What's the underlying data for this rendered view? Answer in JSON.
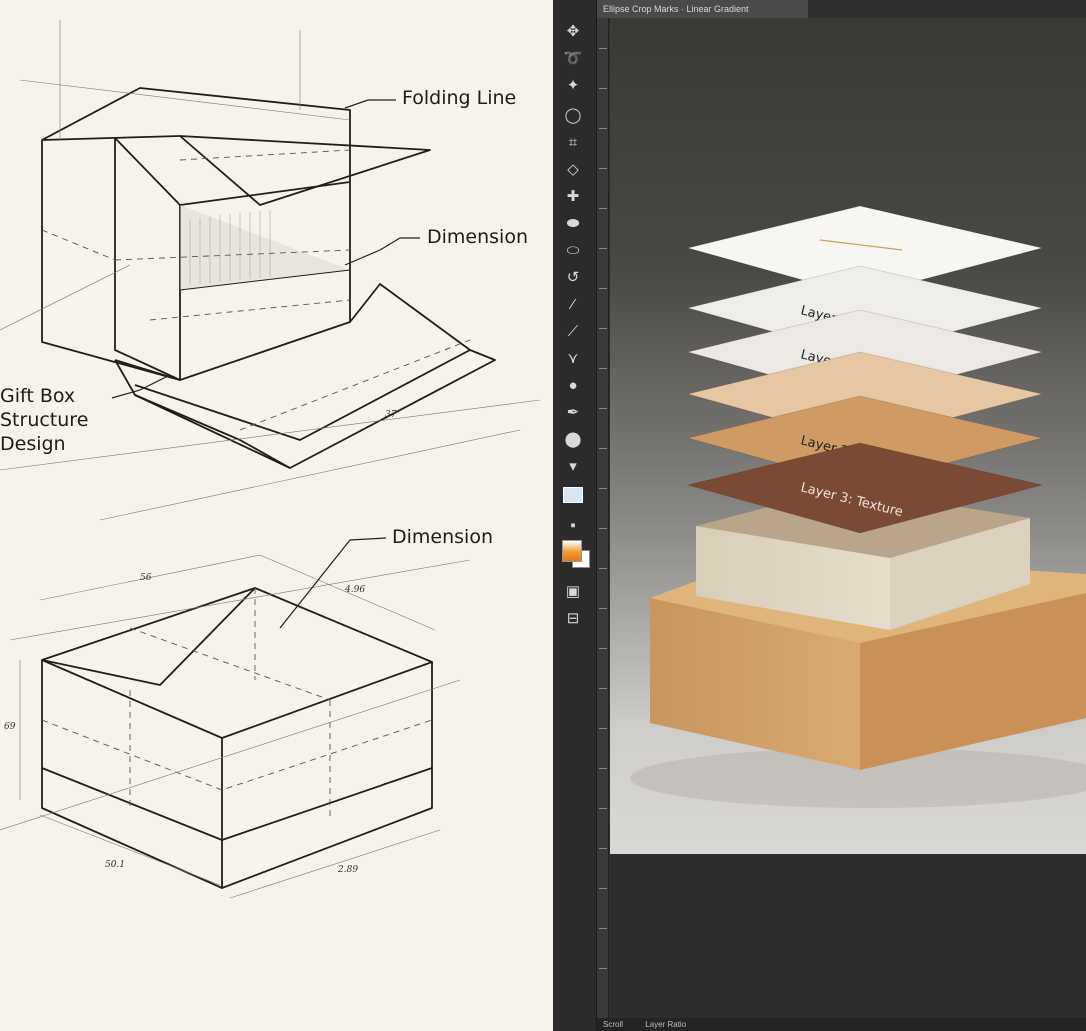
{
  "sketch": {
    "labels": {
      "folding_line": "Folding Line",
      "dimension_top": "Dimension",
      "gift_box_line1": "Gift Box",
      "gift_box_line2": "Structure",
      "gift_box_line3": "Design",
      "dimension_bottom": "Dimension"
    },
    "dimensions": {
      "tray": "37",
      "width": "56",
      "depth": "4.96",
      "height": "69",
      "base_left": "50.1",
      "base_right": "2.89"
    }
  },
  "editor": {
    "menubar": "Ellipse Crop Marks · Linear Gradient",
    "statusbar": {
      "left": "Scroll",
      "right": "Layer Ratio"
    },
    "tools": [
      "move-icon",
      "lasso-icon",
      "magic-wand-icon",
      "ellipse-select-icon",
      "crop-icon",
      "eyedropper-icon",
      "healing-brush-icon",
      "brush-icon",
      "stamp-icon",
      "history-brush-icon",
      "eraser-icon",
      "gradient-icon",
      "blur-icon",
      "dodge-icon",
      "pen-icon",
      "text-icon",
      "path-select-icon",
      "shape-icon",
      "hand-icon",
      "zoom-icon"
    ],
    "colors": {
      "foreground": "#f29a2e",
      "background": "#ffffff"
    },
    "canvas": {
      "layers": [
        {
          "label": "",
          "color": "#f7f6f3",
          "has_gold_text": true
        },
        {
          "label": "Layer 1: Box Body",
          "color": "#efede9"
        },
        {
          "label": "Layer 2: Lid",
          "color": "#ece9e4"
        },
        {
          "label": "",
          "color": "#e6c7a2"
        },
        {
          "label": "Layer 2: Lid",
          "color": "#cf9a64"
        },
        {
          "label": "Layer 3: Texture",
          "color": "#7a4a33"
        }
      ]
    }
  }
}
